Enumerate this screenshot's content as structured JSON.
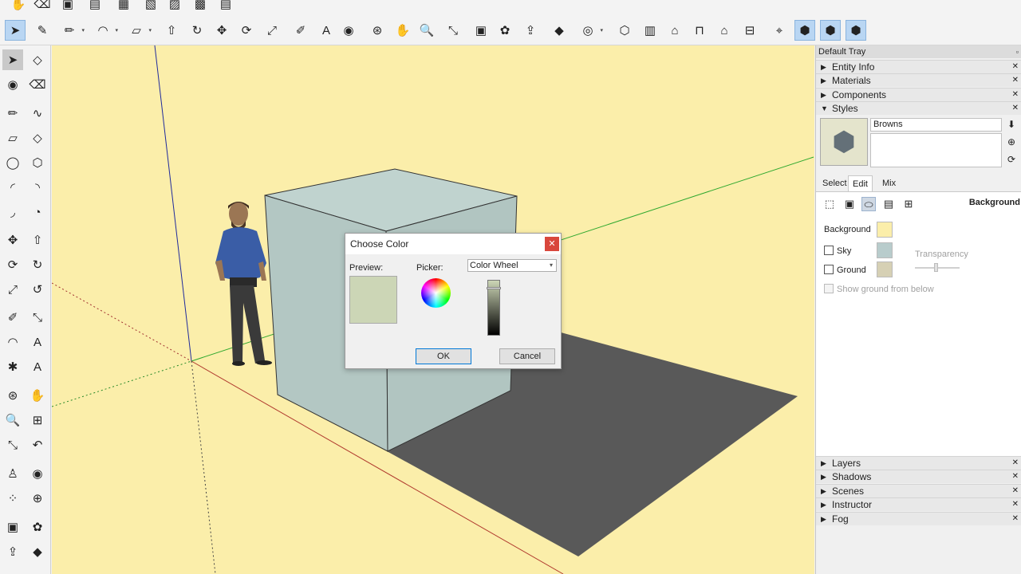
{
  "dialog": {
    "title": "Choose Color",
    "close_label": "✕",
    "preview_label": "Preview:",
    "picker_label": "Picker:",
    "picker_value": "Color Wheel",
    "ok_label": "OK",
    "cancel_label": "Cancel",
    "preview_color": "#ccd6b6"
  },
  "tray": {
    "title": "Default Tray",
    "panels_top": [
      {
        "name": "Entity Info"
      },
      {
        "name": "Materials"
      },
      {
        "name": "Components"
      },
      {
        "name": "Styles"
      }
    ],
    "styles": {
      "style_name": "Browns",
      "tabs": [
        "Select",
        "Edit",
        "Mix"
      ],
      "section_title": "Background",
      "background_label": "Background",
      "sky_label": "Sky",
      "ground_label": "Ground",
      "transparency_label": "Transparency",
      "show_ground_label": "Show ground from below",
      "background_color": "#fbeeaa",
      "sky_color": "#b8cccc",
      "ground_color": "#d6d0b4"
    },
    "panels_bottom": [
      {
        "name": "Layers"
      },
      {
        "name": "Shadows"
      },
      {
        "name": "Scenes"
      },
      {
        "name": "Instructor"
      },
      {
        "name": "Fog"
      }
    ]
  },
  "viewport": {
    "background_color": "#fbeeaa",
    "box_color": "#b5c9c5",
    "shadow_color": "#595959"
  }
}
